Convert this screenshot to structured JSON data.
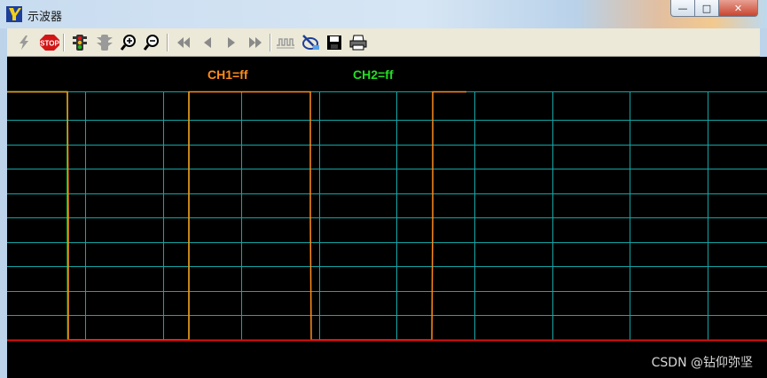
{
  "window": {
    "title": "示波器",
    "colors": {
      "titlebar": "#c8dcf0",
      "toolbar": "#ece9d8",
      "scope_bg": "#000000"
    }
  },
  "window_buttons": {
    "minimize_label": "—",
    "maximize_label": "□",
    "close_label": "✕"
  },
  "toolbar": {
    "buttons": [
      {
        "name": "run-button",
        "icon": "lightning-icon"
      },
      {
        "name": "stop-button",
        "icon": "stop-sign-icon",
        "label": "STOP"
      },
      {
        "name": "traffic-light-button",
        "icon": "traffic-light-icon"
      },
      {
        "name": "stack-button",
        "icon": "stack-icon"
      },
      {
        "name": "zoom-in-button",
        "icon": "zoom-in-icon"
      },
      {
        "name": "zoom-out-button",
        "icon": "zoom-out-icon"
      },
      {
        "name": "rewind-button",
        "icon": "rewind-icon"
      },
      {
        "name": "step-back-button",
        "icon": "step-back-icon"
      },
      {
        "name": "step-forward-button",
        "icon": "step-forward-icon"
      },
      {
        "name": "fast-forward-button",
        "icon": "fast-forward-icon"
      },
      {
        "name": "waveform-button",
        "icon": "waveform-icon"
      },
      {
        "name": "probe-button",
        "icon": "probe-icon"
      },
      {
        "name": "save-button",
        "icon": "floppy-disk-icon"
      },
      {
        "name": "print-button",
        "icon": "printer-icon"
      }
    ]
  },
  "scope": {
    "ch1_label": "CH1=ff",
    "ch2_label": "CH2=ff",
    "grid_color": "#15a6a6",
    "ch1_color": "#ff8c1a",
    "ch2_color": "#22e022",
    "baseline_color": "#e01010",
    "watermark": "CSDN @钻仰弥坚"
  }
}
